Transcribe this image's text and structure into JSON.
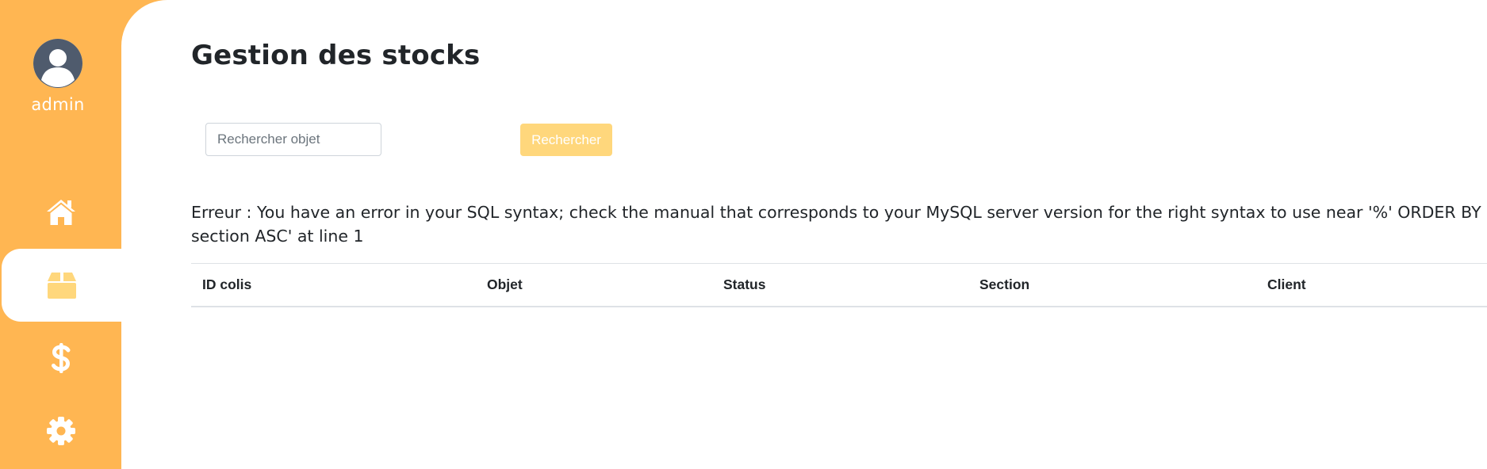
{
  "colors": {
    "sidebar_bg": "#ffb652",
    "active_icon": "#ffd77c",
    "button_bg": "#ffd77c",
    "avatar": "#4f5b6d"
  },
  "sidebar": {
    "username": "admin",
    "nav": [
      {
        "name": "home",
        "icon": "home-icon",
        "active": false
      },
      {
        "name": "stock",
        "icon": "box-icon",
        "active": true
      },
      {
        "name": "finance",
        "icon": "dollar-icon",
        "active": false
      },
      {
        "name": "settings",
        "icon": "gear-icon",
        "active": false
      }
    ]
  },
  "main": {
    "title": "Gestion des stocks",
    "search": {
      "placeholder": "Rechercher objet",
      "value": "",
      "button_label": "Rechercher"
    },
    "error_message": "Erreur : You have an error in your SQL syntax; check the manual that corresponds to your MySQL server version for the right syntax to use near '%' ORDER BY section ASC' at line 1",
    "table": {
      "columns": [
        "ID colis",
        "Objet",
        "Status",
        "Section",
        "Client"
      ],
      "rows": []
    }
  }
}
